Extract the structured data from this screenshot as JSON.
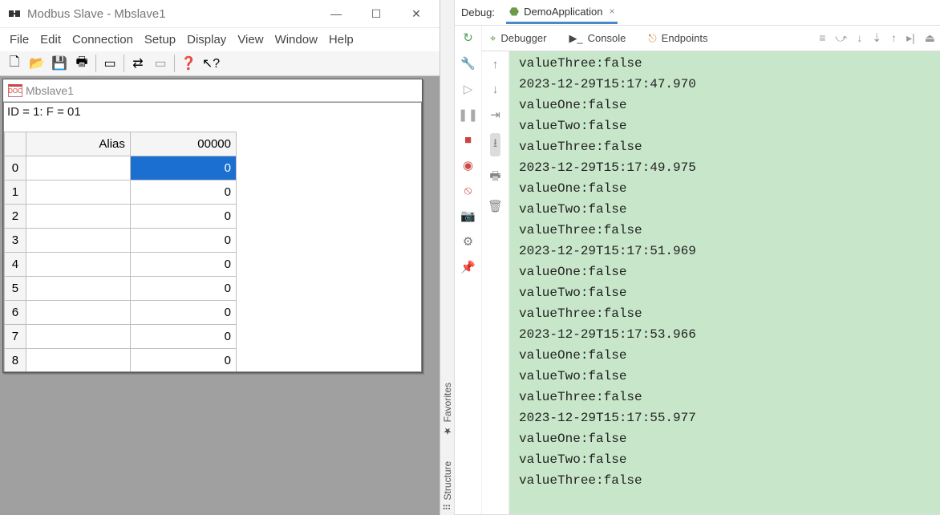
{
  "modbus": {
    "title": "Modbus Slave - Mbslave1",
    "menus": [
      "File",
      "Edit",
      "Connection",
      "Setup",
      "Display",
      "View",
      "Window",
      "Help"
    ],
    "child_title": "Mbslave1",
    "status": "ID = 1: F = 01",
    "headers": {
      "alias": "Alias",
      "col0": "00000"
    },
    "rows": [
      {
        "n": "0",
        "alias": "",
        "val": "0",
        "selected": true
      },
      {
        "n": "1",
        "alias": "",
        "val": "0"
      },
      {
        "n": "2",
        "alias": "",
        "val": "0"
      },
      {
        "n": "3",
        "alias": "",
        "val": "0"
      },
      {
        "n": "4",
        "alias": "",
        "val": "0"
      },
      {
        "n": "5",
        "alias": "",
        "val": "0"
      },
      {
        "n": "6",
        "alias": "",
        "val": "0"
      },
      {
        "n": "7",
        "alias": "",
        "val": "0"
      },
      {
        "n": "8",
        "alias": "",
        "val": "0"
      }
    ]
  },
  "ide": {
    "debug_label": "Debug:",
    "run_config": "DemoApplication",
    "subtabs": {
      "debugger": "Debugger",
      "console": "Console",
      "endpoints": "Endpoints"
    },
    "side_tabs": {
      "structure": "Structure",
      "favorites": "Favorites"
    },
    "console_lines": [
      "valueThree:false",
      "2023-12-29T15:17:47.970",
      "valueOne:false",
      "valueTwo:false",
      "valueThree:false",
      "2023-12-29T15:17:49.975",
      "valueOne:false",
      "valueTwo:false",
      "valueThree:false",
      "2023-12-29T15:17:51.969",
      "valueOne:false",
      "valueTwo:false",
      "valueThree:false",
      "2023-12-29T15:17:53.966",
      "valueOne:false",
      "valueTwo:false",
      "valueThree:false",
      "2023-12-29T15:17:55.977",
      "valueOne:false",
      "valueTwo:false",
      "valueThree:false"
    ]
  }
}
